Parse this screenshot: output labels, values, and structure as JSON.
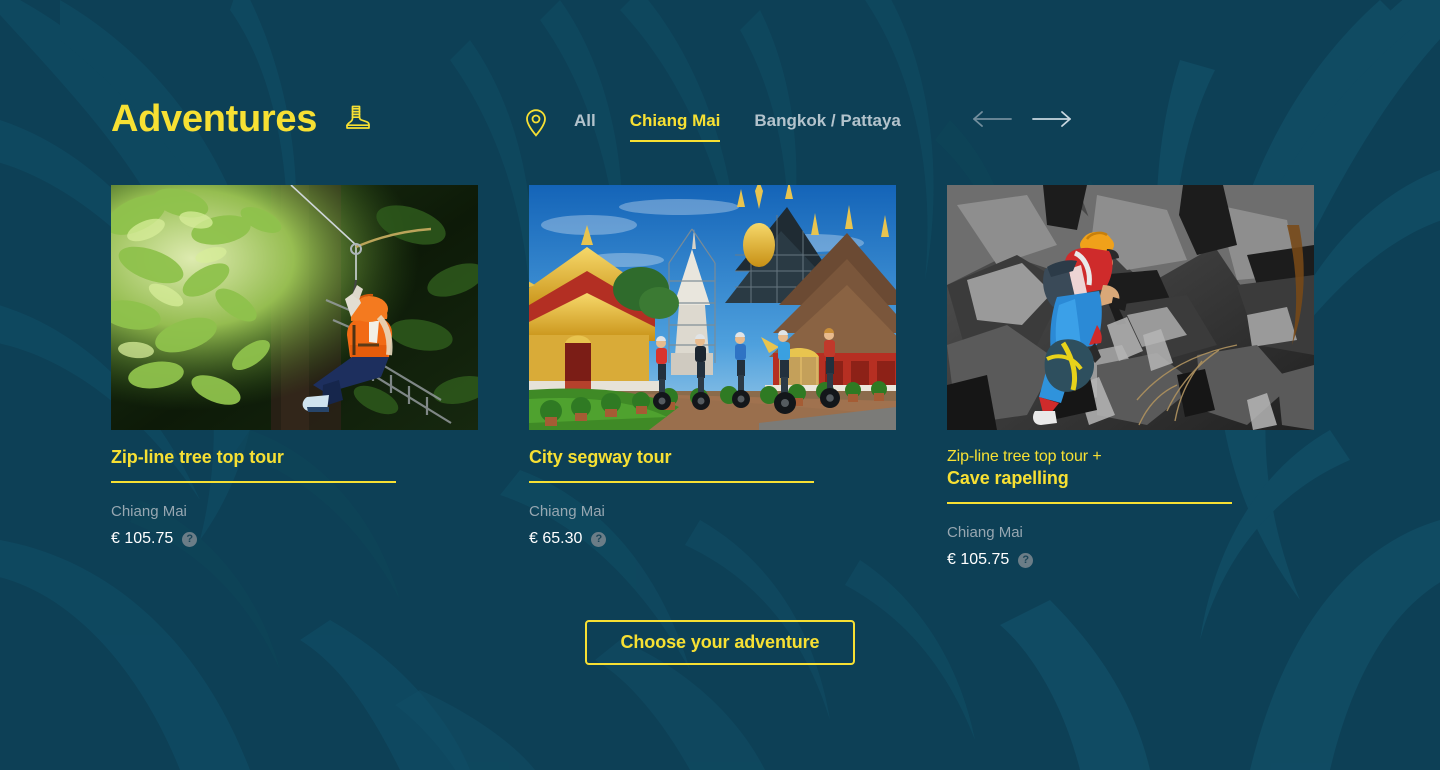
{
  "theme": {
    "background": "#0d4056",
    "accent": "#f7e033",
    "muted_text": "#97a7b1",
    "white_text": "#ffffff",
    "nav_inactive": "#b3c3cc"
  },
  "header": {
    "title": "Adventures",
    "title_icon": "hiking-boot-icon",
    "location_icon": "map-pin-icon",
    "filters": [
      {
        "label": "All",
        "active": false
      },
      {
        "label": "Chiang Mai",
        "active": true
      },
      {
        "label": "Bangkok / Pattaya",
        "active": false
      }
    ],
    "prev_arrow": "arrow-left-icon",
    "next_arrow": "arrow-right-icon"
  },
  "cards": [
    {
      "title_line1": "",
      "title_line2": "Zip-line tree top tour",
      "image_alt": "zip-line-rider-in-jungle",
      "location": "Chiang Mai",
      "price": "€ 105.75",
      "info_icon": "question-mark-icon"
    },
    {
      "title_line1": "",
      "title_line2": "City segway tour",
      "image_alt": "segway-riders-at-thai-temple",
      "location": "Chiang Mai",
      "price": "€ 65.30",
      "info_icon": "question-mark-icon"
    },
    {
      "title_line1": "Zip-line tree top tour +",
      "title_line2": "Cave rapelling",
      "image_alt": "rock-climber-on-cave-wall",
      "location": "Chiang Mai",
      "price": "€ 105.75",
      "info_icon": "question-mark-icon"
    }
  ],
  "cta": {
    "label": "Choose your adventure"
  }
}
